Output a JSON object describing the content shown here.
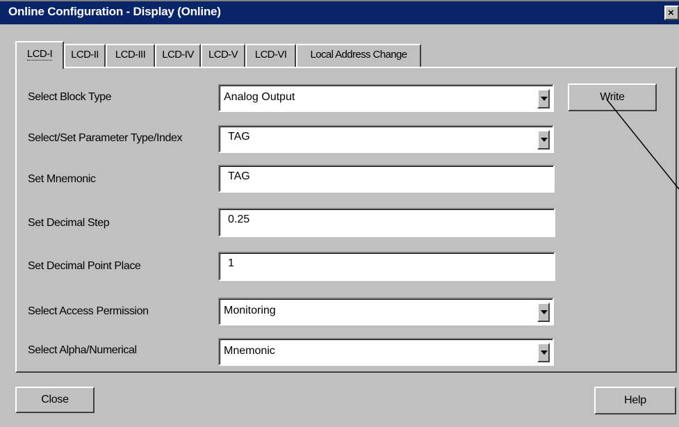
{
  "window": {
    "title": "Online Configuration - Display  (Online)",
    "close_glyph": "×"
  },
  "tabs": [
    {
      "label": "LCD-I",
      "active": true
    },
    {
      "label": "LCD-II"
    },
    {
      "label": "LCD-III"
    },
    {
      "label": "LCD-IV"
    },
    {
      "label": "LCD-V"
    },
    {
      "label": "LCD-VI"
    },
    {
      "label": "Local Address Change"
    }
  ],
  "form": {
    "block_type": {
      "label": "Select Block Type",
      "value": "Analog Output"
    },
    "param_type": {
      "label": "Select/Set Parameter Type/Index",
      "value": "TAG"
    },
    "mnemonic": {
      "label": "Set Mnemonic",
      "value": "TAG"
    },
    "decimal_step": {
      "label": "Set Decimal Step",
      "value": "0.25"
    },
    "decimal_point": {
      "label": "Set Decimal Point Place",
      "value": "1"
    },
    "access": {
      "label": "Select Access Permission",
      "value": "Monitoring"
    },
    "alpha": {
      "label": "Select Alpha/Numerical",
      "value": "Mnemonic"
    }
  },
  "buttons": {
    "write": "Write",
    "close": "Close",
    "help": "Help"
  },
  "icons": {
    "dropdown": "chevron-down-icon",
    "close": "close-icon"
  }
}
